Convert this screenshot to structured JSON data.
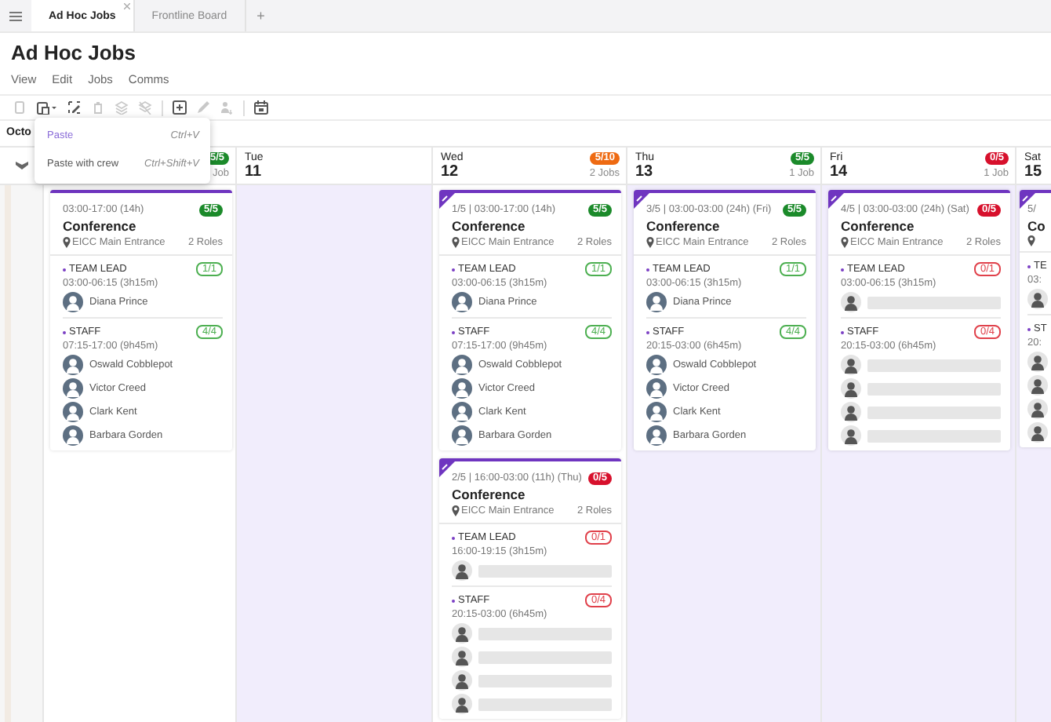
{
  "tabs": [
    {
      "label": "Ad Hoc Jobs",
      "selected": true
    },
    {
      "label": "Frontline Board",
      "selected": false
    }
  ],
  "add_tab": "+",
  "page_title": "Ad Hoc Jobs",
  "menu": [
    "View",
    "Edit",
    "Jobs",
    "Comms"
  ],
  "toolbar": [
    [
      {
        "disabled": true
      },
      {
        "disabled": false
      },
      {
        "disabled": false
      },
      {
        "disabled": true
      },
      {
        "disabled": true
      },
      {
        "disabled": true
      }
    ],
    [
      {
        "disabled": false
      },
      {
        "disabled": true
      },
      {
        "disabled": true
      }
    ],
    [
      {
        "disabled": false
      }
    ]
  ],
  "month": "Octo",
  "dropdown": [
    {
      "label": "Paste",
      "shortcut": "Ctrl+V",
      "selected": true
    },
    {
      "label": "Paste with crew",
      "shortcut": "Ctrl+Shift+V",
      "selected": false
    }
  ],
  "days": [
    {
      "count": "Job",
      "badge": {
        "text": "5/5",
        "color": "#1b8a2a"
      },
      "shaded": false,
      "jobs": [
        {
          "tagged": false,
          "meta": "03:00-17:00 (14h)",
          "badge": {
            "text": "5/5",
            "color": "#1b8a2a"
          },
          "title": "Conference",
          "location": "EICC Main Entrance",
          "roles_count": "2 Roles",
          "roles": [
            {
              "name": "TEAM LEAD",
              "badge": {
                "text": "1/1",
                "color": "#4caf50"
              },
              "time": "03:00-06:15 (3h15m)",
              "slots": [
                {
                  "kind": "person",
                  "name": "Diana Prince"
                }
              ]
            },
            {
              "name": "STAFF",
              "badge": {
                "text": "4/4",
                "color": "#4caf50"
              },
              "time": "07:15-17:00 (9h45m)",
              "slots": [
                {
                  "kind": "person",
                  "name": "Oswald Cobblepot"
                },
                {
                  "kind": "person",
                  "name": "Victor Creed"
                },
                {
                  "kind": "person",
                  "name": "Clark Kent"
                },
                {
                  "kind": "person",
                  "name": "Barbara Gorden"
                }
              ]
            }
          ]
        }
      ]
    },
    {
      "name": "Tue",
      "date": "11",
      "shaded": true
    },
    {
      "name": "Wed",
      "date": "12",
      "count": "2 Jobs",
      "badge": {
        "text": "5/10",
        "color": "#ee6a12"
      },
      "shaded": false,
      "jobs": [
        {
          "tagged": true,
          "meta": "1/5 | 03:00-17:00 (14h)",
          "badge": {
            "text": "5/5",
            "color": "#1b8a2a"
          },
          "title": "Conference",
          "location": "EICC Main Entrance",
          "roles_count": "2 Roles",
          "roles": [
            {
              "name": "TEAM LEAD",
              "badge": {
                "text": "1/1",
                "color": "#4caf50"
              },
              "time": "03:00-06:15 (3h15m)",
              "slots": [
                {
                  "kind": "person",
                  "name": "Diana Prince"
                }
              ]
            },
            {
              "name": "STAFF",
              "badge": {
                "text": "4/4",
                "color": "#4caf50"
              },
              "time": "07:15-17:00 (9h45m)",
              "slots": [
                {
                  "kind": "person",
                  "name": "Oswald Cobblepot"
                },
                {
                  "kind": "person",
                  "name": "Victor Creed"
                },
                {
                  "kind": "person",
                  "name": "Clark Kent"
                },
                {
                  "kind": "person",
                  "name": "Barbara Gorden"
                }
              ]
            }
          ]
        },
        {
          "tagged": true,
          "meta": "2/5 | 16:00-03:00 (11h) (Thu)",
          "badge": {
            "text": "0/5",
            "color": "#d7102c"
          },
          "title": "Conference",
          "location": "EICC Main Entrance",
          "roles_count": "2 Roles",
          "roles": [
            {
              "name": "TEAM LEAD",
              "badge": {
                "text": "0/1",
                "color": "#e0404a"
              },
              "time": "16:00-19:15 (3h15m)",
              "slots": [
                {
                  "kind": "empty"
                }
              ]
            },
            {
              "name": "STAFF",
              "badge": {
                "text": "0/4",
                "color": "#e0404a"
              },
              "time": "20:15-03:00 (6h45m)",
              "slots": [
                {
                  "kind": "empty"
                },
                {
                  "kind": "empty"
                },
                {
                  "kind": "empty"
                },
                {
                  "kind": "empty"
                }
              ]
            }
          ]
        }
      ]
    },
    {
      "name": "Thu",
      "date": "13",
      "count": "1 Job",
      "badge": {
        "text": "5/5",
        "color": "#1b8a2a"
      },
      "shaded": true,
      "jobs": [
        {
          "tagged": true,
          "meta": "3/5 | 03:00-03:00 (24h) (Fri)",
          "badge": {
            "text": "5/5",
            "color": "#1b8a2a"
          },
          "title": "Conference",
          "location": "EICC Main Entrance",
          "roles_count": "2 Roles",
          "roles": [
            {
              "name": "TEAM LEAD",
              "badge": {
                "text": "1/1",
                "color": "#4caf50"
              },
              "time": "03:00-06:15 (3h15m)",
              "slots": [
                {
                  "kind": "person",
                  "name": "Diana Prince"
                }
              ]
            },
            {
              "name": "STAFF",
              "badge": {
                "text": "4/4",
                "color": "#4caf50"
              },
              "time": "20:15-03:00 (6h45m)",
              "slots": [
                {
                  "kind": "person",
                  "name": "Oswald Cobblepot"
                },
                {
                  "kind": "person",
                  "name": "Victor Creed"
                },
                {
                  "kind": "person",
                  "name": "Clark Kent"
                },
                {
                  "kind": "person",
                  "name": "Barbara Gorden"
                }
              ]
            }
          ]
        }
      ]
    },
    {
      "name": "Fri",
      "date": "14",
      "count": "1 Job",
      "badge": {
        "text": "0/5",
        "color": "#d7102c"
      },
      "shaded": true,
      "jobs": [
        {
          "tagged": true,
          "meta": "4/5 | 03:00-03:00 (24h) (Sat)",
          "badge": {
            "text": "0/5",
            "color": "#d7102c"
          },
          "title": "Conference",
          "location": "EICC Main Entrance",
          "roles_count": "2 Roles",
          "roles": [
            {
              "name": "TEAM LEAD",
              "badge": {
                "text": "0/1",
                "color": "#e0404a"
              },
              "time": "03:00-06:15 (3h15m)",
              "slots": [
                {
                  "kind": "empty"
                }
              ]
            },
            {
              "name": "STAFF",
              "badge": {
                "text": "0/4",
                "color": "#e0404a"
              },
              "time": "20:15-03:00 (6h45m)",
              "slots": [
                {
                  "kind": "empty"
                },
                {
                  "kind": "empty"
                },
                {
                  "kind": "empty"
                },
                {
                  "kind": "empty"
                }
              ]
            }
          ]
        }
      ]
    },
    {
      "name": "Sat",
      "date": "15",
      "shaded": true,
      "jobs": [
        {
          "tagged": true,
          "meta": "5/",
          "title": "Co",
          "roles": [
            {
              "name": "TE",
              "time": "03:",
              "slots": [
                {
                  "kind": "empty"
                }
              ]
            },
            {
              "name": "ST",
              "time": "20:",
              "slots": [
                {
                  "kind": "empty"
                },
                {
                  "kind": "empty"
                },
                {
                  "kind": "empty"
                },
                {
                  "kind": "empty"
                }
              ]
            }
          ]
        }
      ]
    }
  ]
}
